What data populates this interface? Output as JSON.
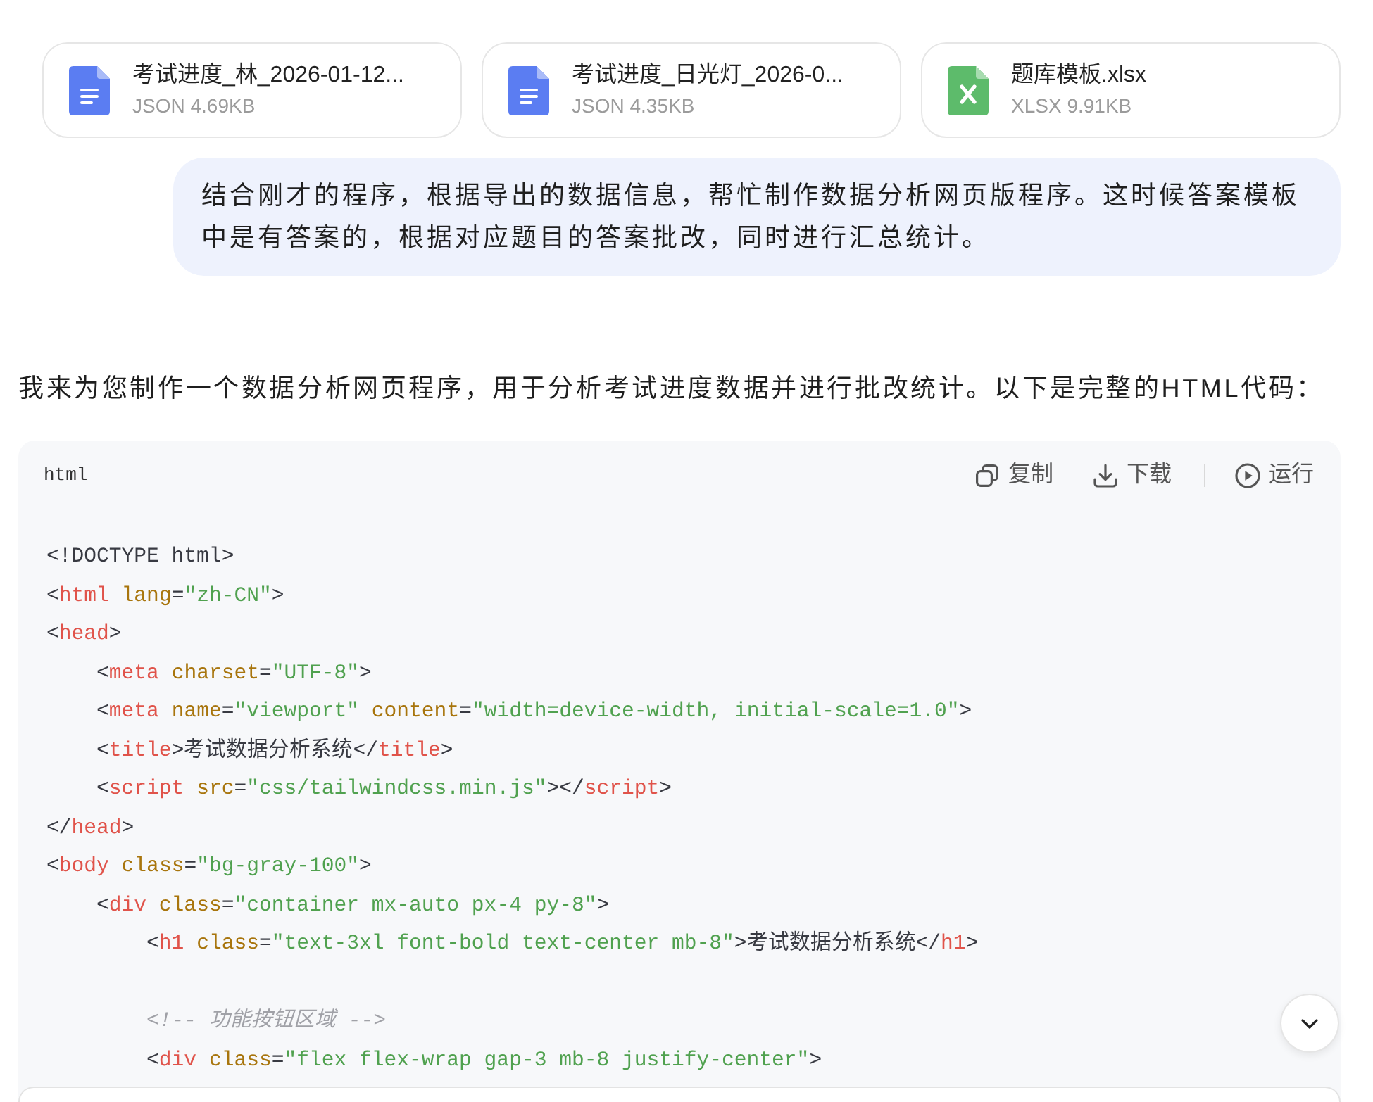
{
  "attachments": [
    {
      "kind": "json",
      "name": "考试进度_林_2026-01-12...",
      "meta": "JSON 4.69KB"
    },
    {
      "kind": "json",
      "name": "考试进度_日光灯_2026-0...",
      "meta": "JSON 4.35KB"
    },
    {
      "kind": "xlsx",
      "name": "题库模板.xlsx",
      "meta": "XLSX 9.91KB"
    }
  ],
  "user_message": {
    "text": "结合刚才的程序，根据导出的数据信息，帮忙制作数据分析网页版程序。这时候答案模板中是有答案的，根据对应题目的答案批改，同时进行汇总统计。"
  },
  "assistant": {
    "text": "我来为您制作一个数据分析网页程序，用于分析考试进度数据并进行批改统计。以下是完整的HTML代码：",
    "code_block": {
      "language": "html",
      "actions": [
        {
          "kind": "copy",
          "label": "复制"
        },
        {
          "kind": "download",
          "label": "下载"
        },
        {
          "kind": "run",
          "label": "运行"
        }
      ],
      "lines": [
        {
          "kind": "code",
          "tokens": [
            {
              "kind": "plain",
              "text": "<!DOCTYPE html>"
            }
          ]
        },
        {
          "kind": "code",
          "tokens": [
            {
              "kind": "plain",
              "text": "<"
            },
            {
              "kind": "tag",
              "text": "html"
            },
            {
              "kind": "attr",
              "text": " lang"
            },
            {
              "kind": "plain",
              "text": "="
            },
            {
              "kind": "string",
              "text": "\"zh-CN\""
            },
            {
              "kind": "plain",
              "text": ">"
            }
          ]
        },
        {
          "kind": "code",
          "tokens": [
            {
              "kind": "plain",
              "text": "<"
            },
            {
              "kind": "tag",
              "text": "head"
            },
            {
              "kind": "plain",
              "text": ">"
            }
          ]
        },
        {
          "kind": "code",
          "tokens": [
            {
              "kind": "plain",
              "text": "    <"
            },
            {
              "kind": "tag",
              "text": "meta"
            },
            {
              "kind": "attr",
              "text": " charset"
            },
            {
              "kind": "plain",
              "text": "="
            },
            {
              "kind": "string",
              "text": "\"UTF-8\""
            },
            {
              "kind": "plain",
              "text": ">"
            }
          ]
        },
        {
          "kind": "code",
          "tokens": [
            {
              "kind": "plain",
              "text": "    <"
            },
            {
              "kind": "tag",
              "text": "meta"
            },
            {
              "kind": "attr",
              "text": " name"
            },
            {
              "kind": "plain",
              "text": "="
            },
            {
              "kind": "string",
              "text": "\"viewport\""
            },
            {
              "kind": "attr",
              "text": " content"
            },
            {
              "kind": "plain",
              "text": "="
            },
            {
              "kind": "string",
              "text": "\"width=device-width, initial-scale=1.0\""
            },
            {
              "kind": "plain",
              "text": ">"
            }
          ]
        },
        {
          "kind": "code",
          "tokens": [
            {
              "kind": "plain",
              "text": "    <"
            },
            {
              "kind": "tag",
              "text": "title"
            },
            {
              "kind": "plain",
              "text": ">考试数据分析系统</"
            },
            {
              "kind": "tag",
              "text": "title"
            },
            {
              "kind": "plain",
              "text": ">"
            }
          ]
        },
        {
          "kind": "code",
          "tokens": [
            {
              "kind": "plain",
              "text": "    <"
            },
            {
              "kind": "tag",
              "text": "script"
            },
            {
              "kind": "attr",
              "text": " src"
            },
            {
              "kind": "plain",
              "text": "="
            },
            {
              "kind": "string",
              "text": "\"css/tailwindcss.min.js\""
            },
            {
              "kind": "plain",
              "text": "></"
            },
            {
              "kind": "tag",
              "text": "script"
            },
            {
              "kind": "plain",
              "text": ">"
            }
          ]
        },
        {
          "kind": "code",
          "tokens": [
            {
              "kind": "plain",
              "text": "</"
            },
            {
              "kind": "tag",
              "text": "head"
            },
            {
              "kind": "plain",
              "text": ">"
            }
          ]
        },
        {
          "kind": "code",
          "tokens": [
            {
              "kind": "plain",
              "text": "<"
            },
            {
              "kind": "tag",
              "text": "body"
            },
            {
              "kind": "attr",
              "text": " class"
            },
            {
              "kind": "plain",
              "text": "="
            },
            {
              "kind": "string",
              "text": "\"bg-gray-100\""
            },
            {
              "kind": "plain",
              "text": ">"
            }
          ]
        },
        {
          "kind": "code",
          "tokens": [
            {
              "kind": "plain",
              "text": "    <"
            },
            {
              "kind": "tag",
              "text": "div"
            },
            {
              "kind": "attr",
              "text": " class"
            },
            {
              "kind": "plain",
              "text": "="
            },
            {
              "kind": "string",
              "text": "\"container mx-auto px-4 py-8\""
            },
            {
              "kind": "plain",
              "text": ">"
            }
          ]
        },
        {
          "kind": "code",
          "tokens": [
            {
              "kind": "plain",
              "text": "        <"
            },
            {
              "kind": "tag",
              "text": "h1"
            },
            {
              "kind": "attr",
              "text": " class"
            },
            {
              "kind": "plain",
              "text": "="
            },
            {
              "kind": "string",
              "text": "\"text-3xl font-bold text-center mb-8\""
            },
            {
              "kind": "plain",
              "text": ">考试数据分析系统</"
            },
            {
              "kind": "tag",
              "text": "h1"
            },
            {
              "kind": "plain",
              "text": ">"
            }
          ]
        },
        {
          "kind": "blank"
        },
        {
          "kind": "code",
          "tokens": [
            {
              "kind": "comment",
              "text": "        <!-- 功能按钮区域 -->"
            }
          ]
        },
        {
          "kind": "code",
          "tokens": [
            {
              "kind": "plain",
              "text": "        <"
            },
            {
              "kind": "tag",
              "text": "div"
            },
            {
              "kind": "attr",
              "text": " class"
            },
            {
              "kind": "plain",
              "text": "="
            },
            {
              "kind": "string",
              "text": "\"flex flex-wrap gap-3 mb-8 justify-center\""
            },
            {
              "kind": "plain",
              "text": ">"
            }
          ]
        }
      ]
    }
  }
}
